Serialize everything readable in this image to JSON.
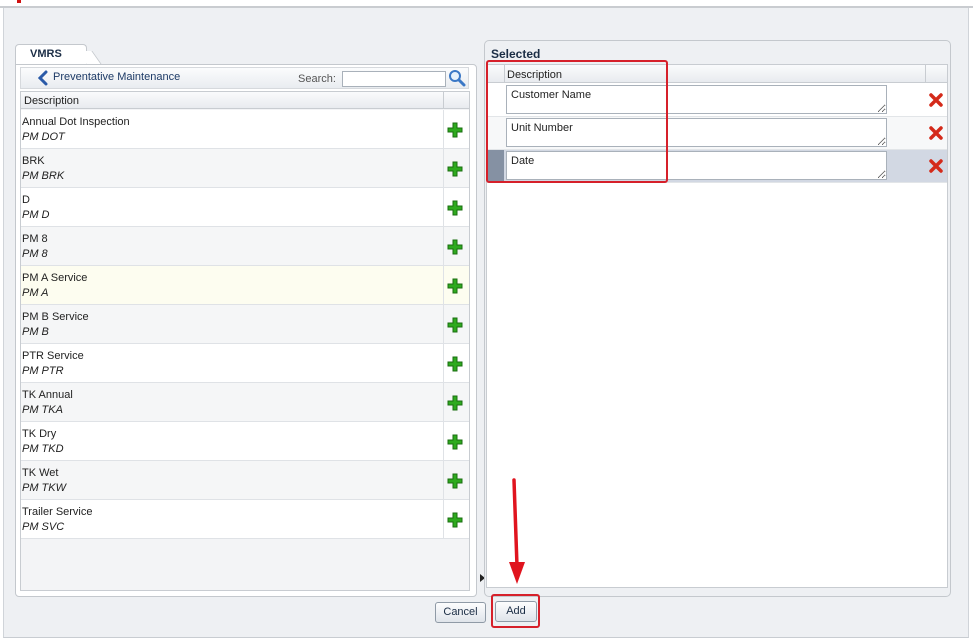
{
  "left_panel": {
    "tab_label": "VMRS",
    "breadcrumb": "Preventative Maintenance",
    "search_label": "Search:",
    "search_value": "",
    "column_header": "Description",
    "items": [
      {
        "name": "Annual Dot Inspection",
        "code": "PM DOT"
      },
      {
        "name": "BRK",
        "code": "PM BRK"
      },
      {
        "name": "D",
        "code": "PM D"
      },
      {
        "name": "PM 8",
        "code": "PM 8"
      },
      {
        "name": "PM A Service",
        "code": "PM A"
      },
      {
        "name": "PM B Service",
        "code": "PM B"
      },
      {
        "name": "PTR Service",
        "code": "PM PTR"
      },
      {
        "name": "TK Annual",
        "code": "PM TKA"
      },
      {
        "name": "TK Dry",
        "code": "PM TKD"
      },
      {
        "name": "TK Wet",
        "code": "PM TKW"
      },
      {
        "name": "Trailer Service",
        "code": "PM SVC"
      }
    ]
  },
  "right_panel": {
    "title": "Selected",
    "column_header": "Description",
    "rows": [
      {
        "value": "Customer Name"
      },
      {
        "value": "Unit Number"
      },
      {
        "value": "Date"
      }
    ]
  },
  "buttons": {
    "cancel": "Cancel",
    "add": "Add"
  },
  "colors": {
    "annotation_red": "#d6202a",
    "add_icon_green": "#2eaa1e",
    "delete_icon_red": "#d42a1a"
  }
}
